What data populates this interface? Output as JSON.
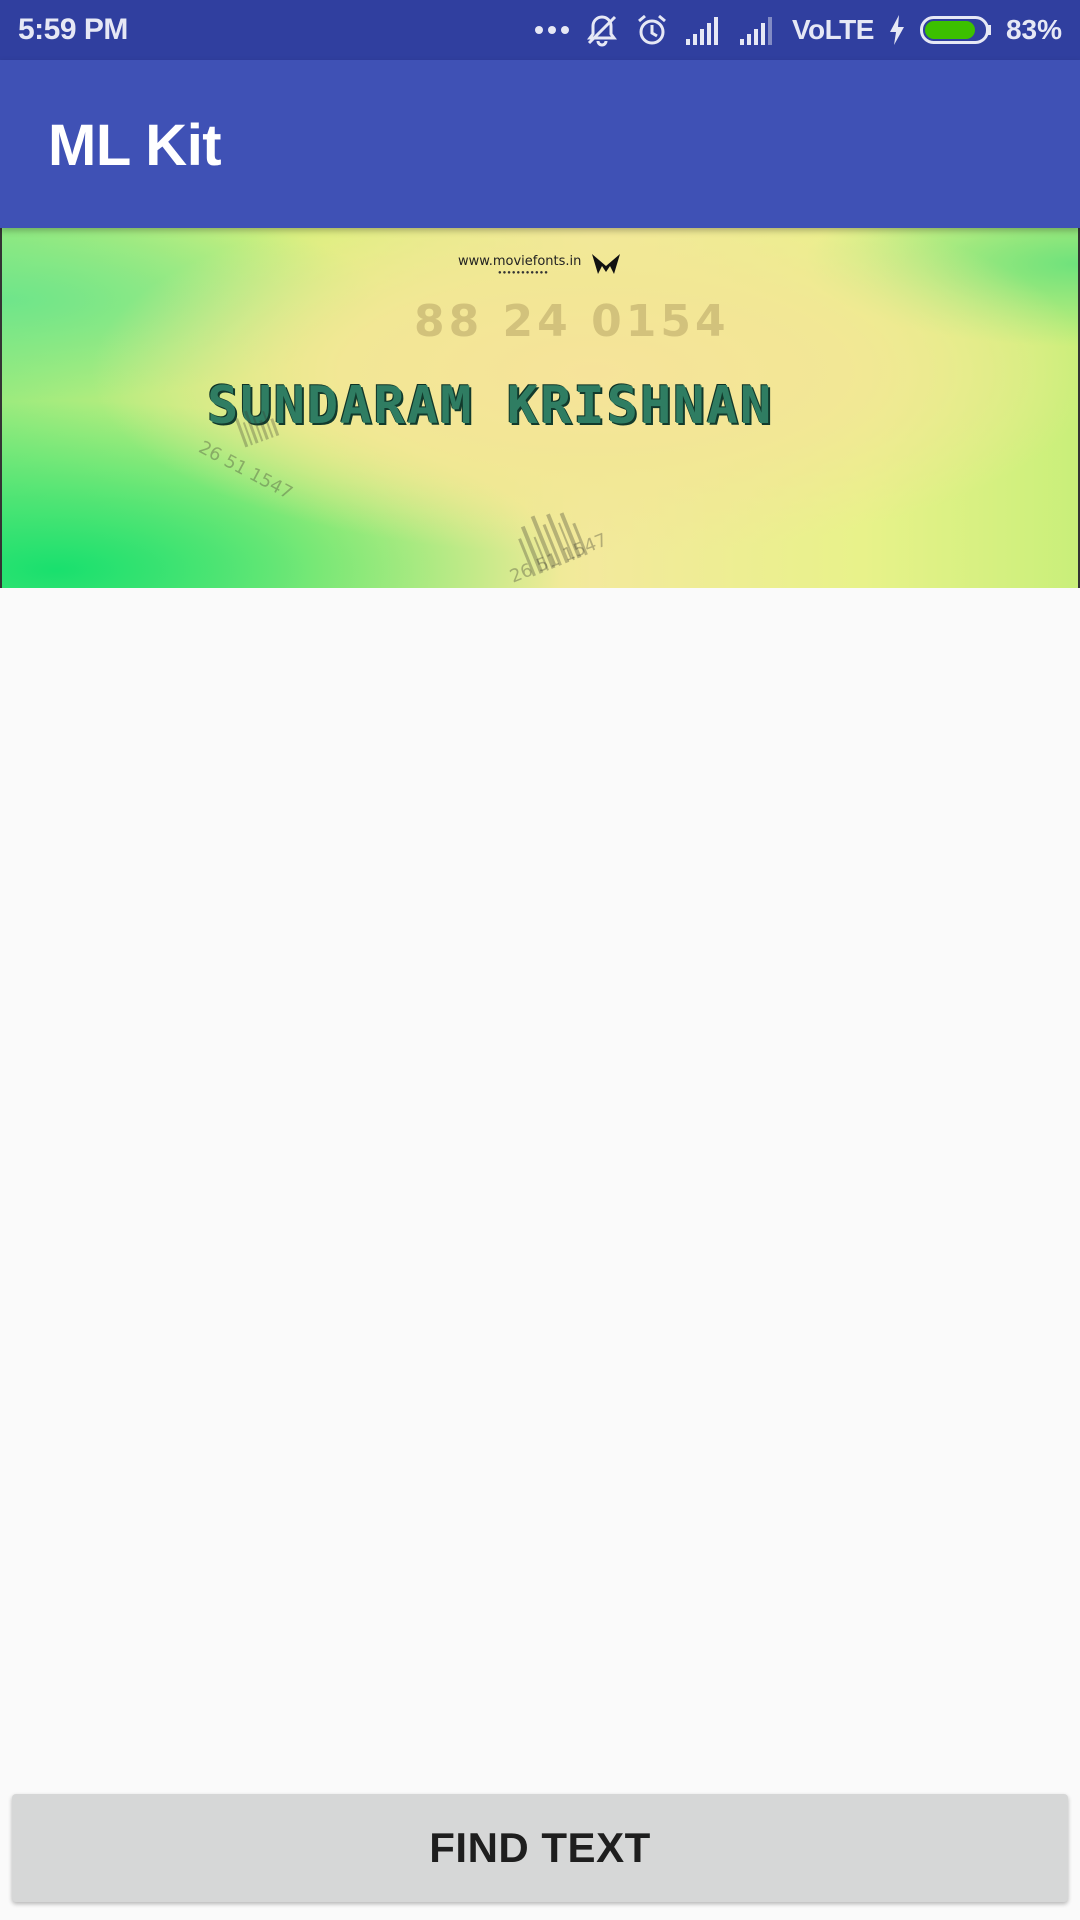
{
  "status_bar": {
    "time": "5:59 PM",
    "network": "VoLTE",
    "battery_percent": "83%",
    "battery_level": 0.83,
    "icons": [
      "more-dots-icon",
      "notifications-off-icon",
      "alarm-icon",
      "signal-icon",
      "signal-icon",
      "charging-bolt-icon",
      "battery-icon"
    ]
  },
  "app_bar": {
    "title": "ML Kit"
  },
  "poster": {
    "url_text": "www.moviefonts.in",
    "number_text": "88 24 0154",
    "title_text": "SUNDARAM KRISHNAN",
    "barcode_text_1": "26 51 1547",
    "barcode_text_2": "26 51 1547"
  },
  "actions": {
    "find_text_label": "FIND TEXT"
  },
  "colors": {
    "status_bar": "#303f9f",
    "app_bar": "#3f51b5",
    "background": "#fafafa",
    "button": "#d6d7d7",
    "battery_fill": "#3cc000"
  }
}
